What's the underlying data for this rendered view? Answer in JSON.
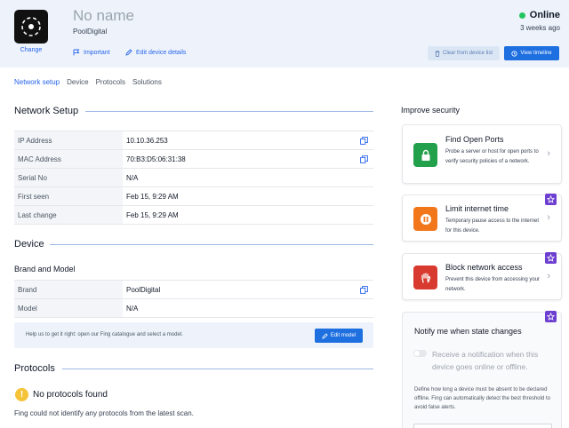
{
  "header": {
    "device_name": "No name",
    "brand": "PoolDigital",
    "change_label": "Change",
    "important_label": "Important",
    "edit_details_label": "Edit device details",
    "status": "Online",
    "last_seen": "3 weeks ago",
    "clear_label": "Clear from device list",
    "timeline_label": "View timeline",
    "status_color": "#22c55e"
  },
  "tabs": [
    {
      "label": "Network setup",
      "active": true
    },
    {
      "label": "Device",
      "active": false
    },
    {
      "label": "Protocols",
      "active": false
    },
    {
      "label": "Solutions",
      "active": false
    }
  ],
  "network_setup": {
    "title": "Network Setup",
    "rows": [
      {
        "label": "IP Address",
        "value": "10.10.36.253",
        "copy": true
      },
      {
        "label": "MAC Address",
        "value": "70:B3:D5:06:31:38",
        "copy": true
      },
      {
        "label": "Serial No",
        "value": "N/A",
        "copy": false
      },
      {
        "label": "First seen",
        "value": "Feb 15, 9:29 AM",
        "copy": false
      },
      {
        "label": "Last change",
        "value": "Feb 15, 9:29 AM",
        "copy": false
      }
    ]
  },
  "device": {
    "title": "Device",
    "subtitle": "Brand and Model",
    "rows": [
      {
        "label": "Brand",
        "value": "PoolDigital",
        "copy": true
      },
      {
        "label": "Model",
        "value": "N/A",
        "copy": false
      }
    ],
    "help_text": "Help us to get it right: open our Fing catalogue and select a model.",
    "edit_model_label": "Edit model"
  },
  "protocols": {
    "title": "Protocols",
    "warning_title": "No protocols found",
    "warning_text": "Fing could not identify any protocols from the latest scan."
  },
  "security": {
    "title": "Improve security",
    "cards": [
      {
        "title": "Find Open Ports",
        "desc": "Probe a server or host for open ports to verify security policies of a network.",
        "icon": "lock-icon",
        "color": "#22a04b",
        "premium": false
      },
      {
        "title": "Limit internet time",
        "desc": "Temporary pause access to the internet for this device.",
        "icon": "pause-icon",
        "color": "#f2771a",
        "premium": true
      },
      {
        "title": "Block network access",
        "desc": "Prevent this device from accessing your network.",
        "icon": "hand-icon",
        "color": "#d93a30",
        "premium": true
      }
    ]
  },
  "notify": {
    "title": "Notify me when state changes",
    "toggle_label": "Receive a notification when this device goes online or offline.",
    "desc": "Define how long a device must be absent to be declared offline. Fing can automatically detect the best threshold to avoid false alerts."
  }
}
